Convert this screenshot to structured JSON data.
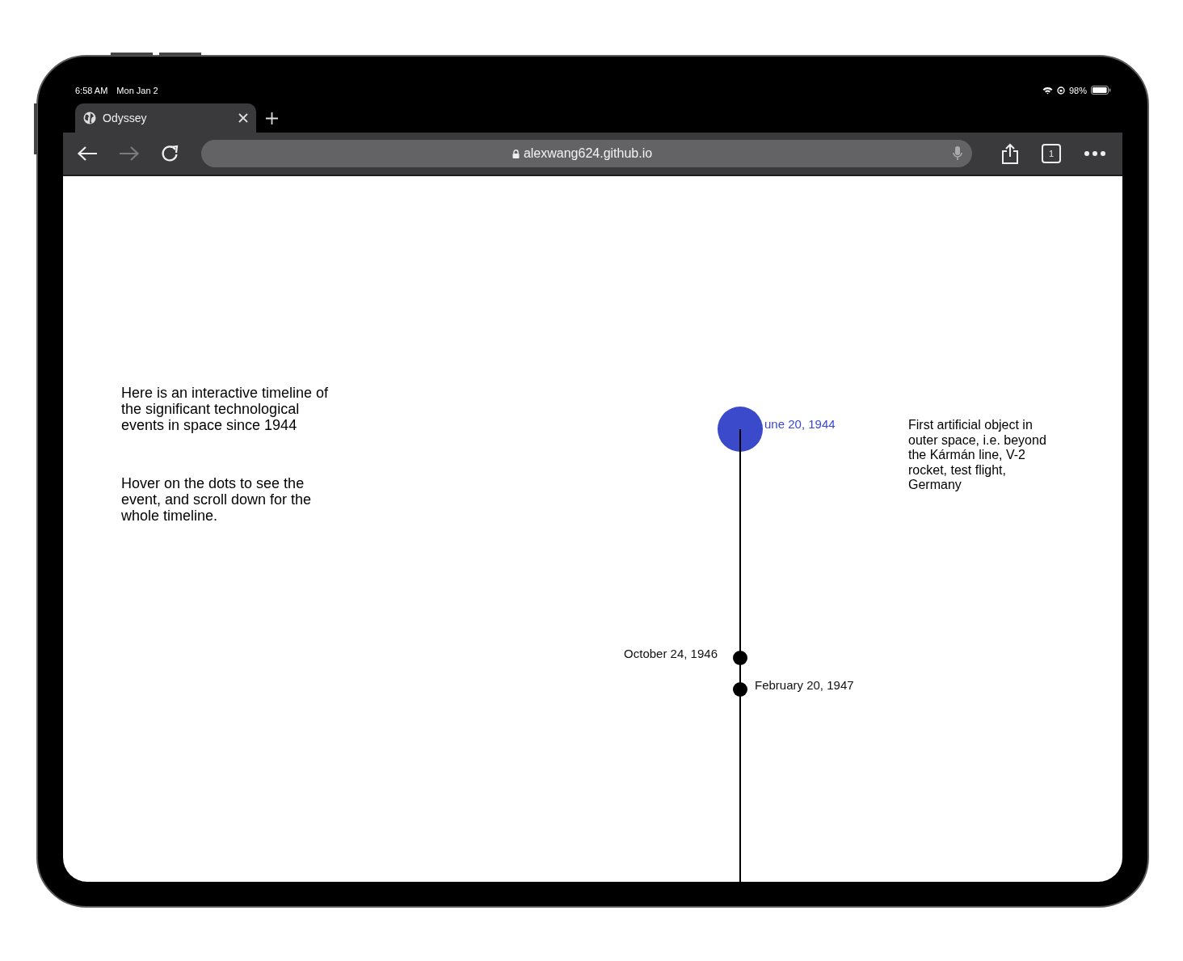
{
  "status_bar": {
    "time": "6:58 AM",
    "date": "Mon Jan 2",
    "battery": "98%"
  },
  "tabs": [
    {
      "title": "Odyssey",
      "selected": true
    }
  ],
  "toolbar": {
    "forward_disabled": true,
    "url": "alexwang624.github.io",
    "tab_count": "1"
  },
  "intro": [
    "Here is an interactive timeline of the significant technological events in space since 1944",
    "Hover on the dots to see the event, and scroll down for the whole timeline."
  ],
  "timeline": {
    "events": [
      {
        "date": "une 20, 1944",
        "label_left": false,
        "selected": true,
        "description": "First artificial object in outer space, i.e. beyond the Kármán line, V-2 rocket, test flight, Germany"
      },
      {
        "date": "October 24, 1946",
        "label_left": true,
        "selected": false
      },
      {
        "date": "February 20, 1947",
        "label_left": false,
        "selected": false
      }
    ]
  }
}
